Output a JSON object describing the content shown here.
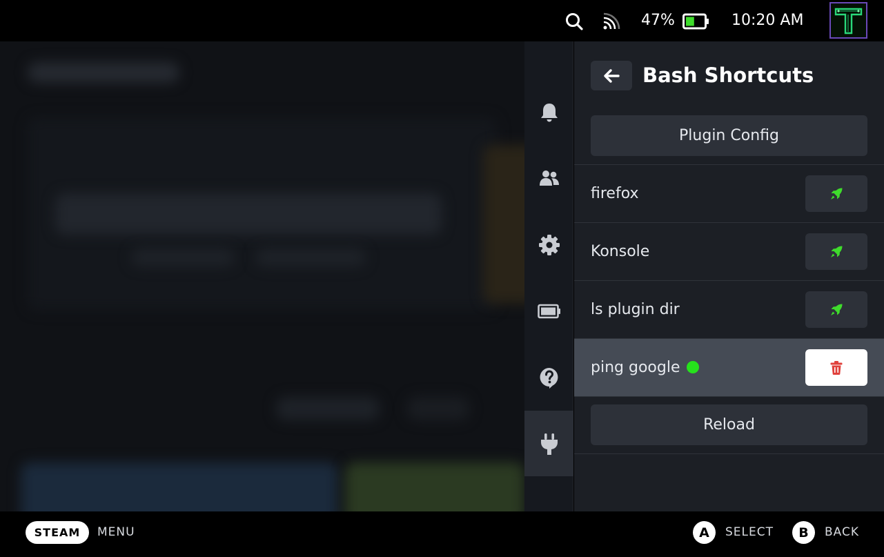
{
  "status_bar": {
    "battery_percent": "47%",
    "battery_level": 0.47,
    "time": "10:20 AM",
    "icons": [
      "search-icon",
      "wifi-signal-icon",
      "battery-icon"
    ],
    "avatar_icon": "user-avatar"
  },
  "side_rail": {
    "items": [
      {
        "icon": "bell-icon",
        "active": false
      },
      {
        "icon": "friends-icon",
        "active": false
      },
      {
        "icon": "gear-icon",
        "active": false
      },
      {
        "icon": "battery-icon",
        "active": false
      },
      {
        "icon": "help-icon",
        "active": false
      },
      {
        "icon": "plug-icon",
        "active": true
      }
    ]
  },
  "panel": {
    "title": "Bash Shortcuts",
    "back_icon": "arrow-left-icon",
    "plugin_config_label": "Plugin Config",
    "shortcuts": [
      {
        "name": "firefox",
        "action_icon": "rocket-icon",
        "running": false,
        "focused": false
      },
      {
        "name": "Konsole",
        "action_icon": "rocket-icon",
        "running": false,
        "focused": false
      },
      {
        "name": "ls plugin dir",
        "action_icon": "rocket-icon",
        "running": false,
        "focused": false
      },
      {
        "name": "ping google",
        "action_icon": "trash-icon",
        "running": true,
        "focused": true
      }
    ],
    "reload_label": "Reload"
  },
  "bottom_bar": {
    "steam_label": "STEAM",
    "menu_label": "MENU",
    "a_button": "A",
    "select_label": "SELECT",
    "b_button": "B",
    "back_label": "BACK"
  },
  "colors": {
    "run_icon": "#3fdc2c",
    "running_dot": "#26e21c",
    "delete_icon": "#e0413c",
    "panel_bg": "#1c1f25",
    "focused_row": "#454b55"
  }
}
